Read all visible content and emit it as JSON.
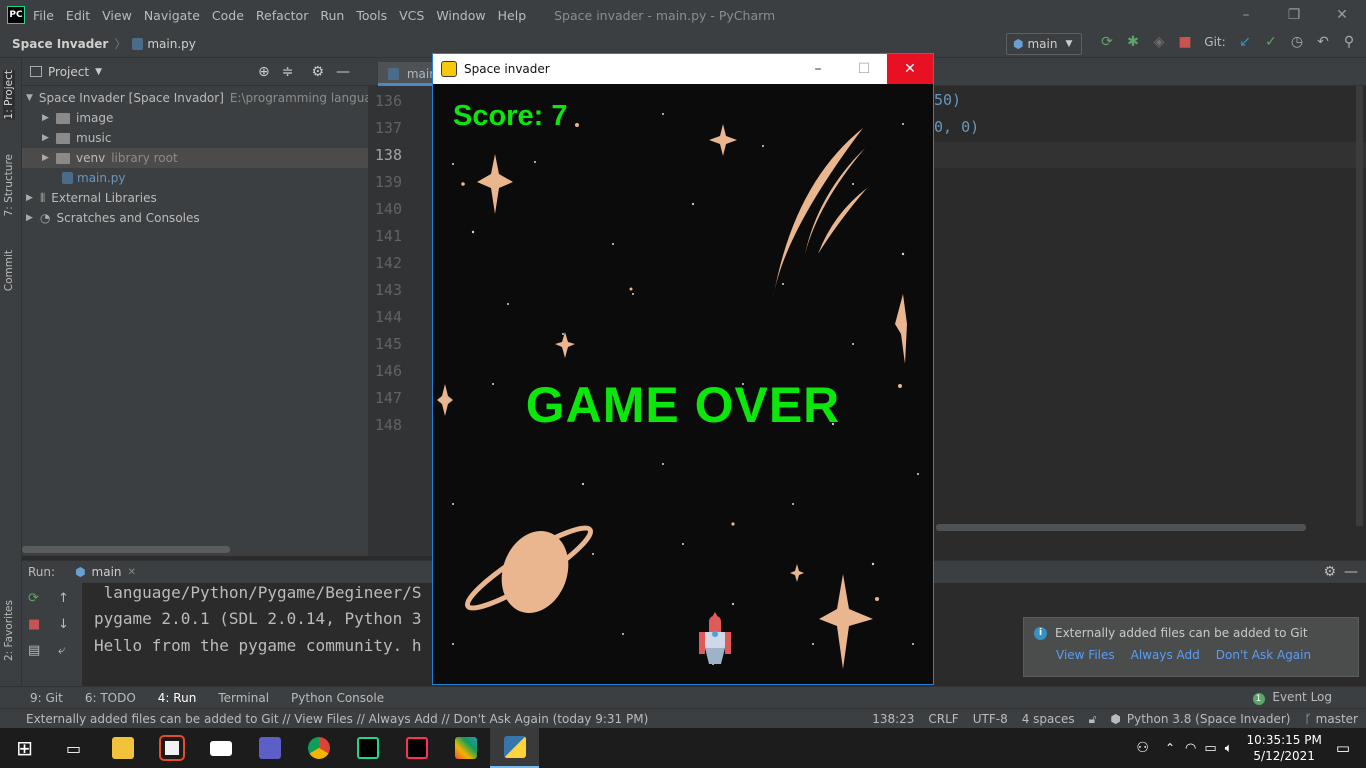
{
  "app": {
    "logo": "PC",
    "menu": [
      "File",
      "Edit",
      "View",
      "Navigate",
      "Code",
      "Refactor",
      "Run",
      "Tools",
      "VCS",
      "Window",
      "Help"
    ],
    "window_title": "Space invader - main.py - PyCharm",
    "window_controls": [
      "–",
      "❐",
      "✕"
    ]
  },
  "navbar": {
    "project": "Space Invader",
    "file": "main.py",
    "run_config": "main",
    "git_label": "Git:"
  },
  "left_tabs": {
    "project": "1: Project",
    "structure": "7: Structure",
    "commit": "Commit",
    "favorites": "2: Favorites"
  },
  "project_panel": {
    "title": "Project",
    "tree": [
      {
        "label": "Space Invader [Space Invador]",
        "hint": "E:\\programming language",
        "level": 0,
        "arrow": "▼"
      },
      {
        "label": "image",
        "hint": "",
        "level": 1,
        "arrow": "▶"
      },
      {
        "label": "music",
        "hint": "",
        "level": 1,
        "arrow": "▶"
      },
      {
        "label": "venv",
        "hint": "library root",
        "level": 1,
        "arrow": "▶"
      },
      {
        "label": "main.py",
        "hint": "",
        "level": 1,
        "arrow": ""
      },
      {
        "label": "External Libraries",
        "hint": "",
        "level": 0,
        "arrow": "▶"
      },
      {
        "label": "Scratches and Consoles",
        "hint": "",
        "level": 0,
        "arrow": "▶"
      }
    ]
  },
  "editor": {
    "tab": "main.py",
    "line_numbers": [
      "136",
      "137",
      "138",
      "139",
      "140",
      "141",
      "142",
      "143",
      "144",
      "145",
      "146",
      "147",
      "148"
    ],
    "code_fragments": [
      "50)",
      "0, 0)"
    ]
  },
  "run": {
    "label": "Run:",
    "config": "main",
    "console": [
      " language/Python/Pygame/Begineer/S",
      "pygame 2.0.1 (SDL 2.0.14, Python 3",
      "Hello from the pygame community. h"
    ]
  },
  "notification": {
    "message": "Externally added files can be added to Git",
    "actions": [
      "View Files",
      "Always Add",
      "Don't Ask Again"
    ]
  },
  "bottom_tabs": [
    "9: Git",
    "6: TODO",
    "4: Run",
    "Terminal",
    "Python Console"
  ],
  "event_log": "Event Log",
  "event_log_count": "1",
  "status": {
    "message": "Externally added files can be added to Git // View Files // Always Add // Don't Ask Again (today 9:31 PM)",
    "position": "138:23",
    "line_sep": "CRLF",
    "encoding": "UTF-8",
    "indent": "4 spaces",
    "interpreter": "Python 3.8 (Space Invader)",
    "branch": "master"
  },
  "game": {
    "title": "Space invader",
    "score": "Score: 7",
    "message": "GAME OVER",
    "controls": [
      "–",
      "☐",
      "✕"
    ]
  },
  "taskbar": {
    "time": "10:35:15 PM",
    "date": "5/12/2021",
    "apps": [
      "windows-start",
      "task-view",
      "file-explorer",
      "microsoft-store",
      "mail",
      "teams",
      "chrome",
      "pycharm",
      "intellij",
      "git",
      "python"
    ]
  },
  "colors": {
    "accent": "#0be70b",
    "close": "#e81123",
    "link": "#589df6"
  }
}
